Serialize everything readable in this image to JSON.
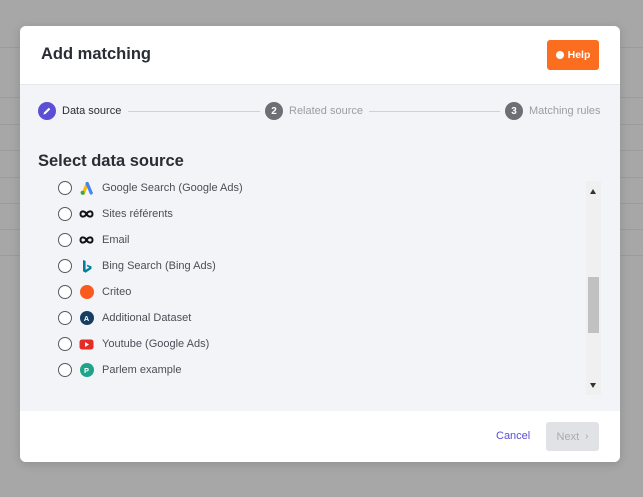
{
  "modal": {
    "title": "Add matching",
    "help_label": "Help"
  },
  "steps": [
    {
      "number": "",
      "label": "Data source",
      "state": "active",
      "icon": "pencil-icon"
    },
    {
      "number": "2",
      "label": "Related source",
      "state": "inactive"
    },
    {
      "number": "3",
      "label": "Matching rules",
      "state": "inactive"
    }
  ],
  "section_title": "Select data source",
  "sources": [
    {
      "label": "Google Search (Google Ads)",
      "icon": "google-ads-icon",
      "selected": false
    },
    {
      "label": "Sites référents",
      "icon": "infinity-icon",
      "selected": false
    },
    {
      "label": "Email",
      "icon": "infinity-icon",
      "selected": false
    },
    {
      "label": "Bing Search (Bing Ads)",
      "icon": "bing-icon",
      "selected": false
    },
    {
      "label": "Criteo",
      "icon": "criteo-icon",
      "selected": false,
      "color": "#fb5a1e"
    },
    {
      "label": "Additional Dataset",
      "icon": "letter-badge-icon",
      "letter": "A",
      "selected": false,
      "color": "#163e62"
    },
    {
      "label": "Youtube (Google Ads)",
      "icon": "youtube-icon",
      "selected": false,
      "color": "#e52d27"
    },
    {
      "label": "Parlem example",
      "icon": "letter-badge-icon",
      "letter": "P",
      "selected": false,
      "color": "#1ea48a"
    }
  ],
  "footer": {
    "cancel_label": "Cancel",
    "next_label": "Next",
    "next_chevron": "›"
  },
  "colors": {
    "accent": "#5b4fd6",
    "help_orange": "#fb6d1f"
  }
}
